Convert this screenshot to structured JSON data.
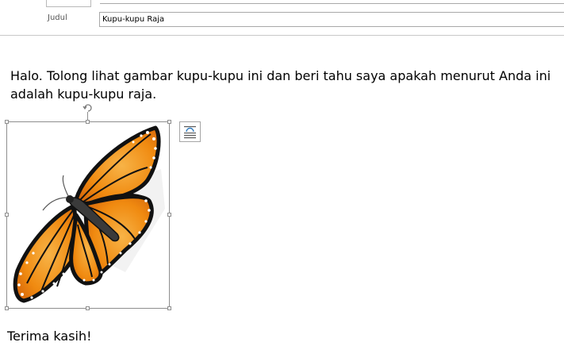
{
  "message": {
    "subject_label": "Judul",
    "subject_value": "Kupu-kupu Raja",
    "body_text": "Halo. Tolong lihat gambar kupu-kupu ini dan beri tahu saya apakah menurut Anda ini adalah kupu-kupu raja.",
    "sign_off": "Terima kasih!"
  },
  "icons": {
    "rotate": "rotate-icon",
    "layout_options": "layout-options-icon",
    "image": "butterfly-image"
  },
  "colors": {
    "wing_orange": "#f08a10",
    "wing_black": "#111111",
    "selection_border": "#8e8e8e"
  }
}
